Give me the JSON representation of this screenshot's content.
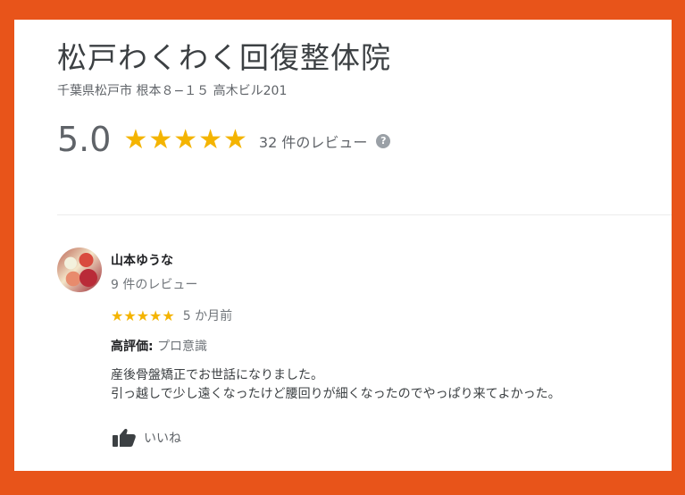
{
  "business": {
    "name": "松戸わくわく回復整体院",
    "address": "千葉県松戸市 根本８−１５ 高木ビル201",
    "rating": "5.0",
    "stars": "★★★★★",
    "review_count": "32 件のレビュー",
    "help_icon_text": "?"
  },
  "review": {
    "author": "山本ゆうな",
    "author_review_count": "9 件のレビュー",
    "stars": "★★★★★",
    "date": "5 か月前",
    "highlight_label": "高評価:",
    "highlight_value": "プロ意識",
    "body_line_1": "産後骨盤矯正でお世話になりました。",
    "body_line_2": "引っ越しで少し遠くなったけど腰回りが細くなったのでやっぱり来てよかった。",
    "like_label": "いいね"
  },
  "colors": {
    "frame": "#e8541a",
    "star": "#f4b400",
    "text": "#3c4043",
    "secondary_text": "#70757a"
  },
  "icons": {
    "help": "help-circle-icon",
    "like": "thumbs-up-icon",
    "avatar": "profile-avatar"
  }
}
